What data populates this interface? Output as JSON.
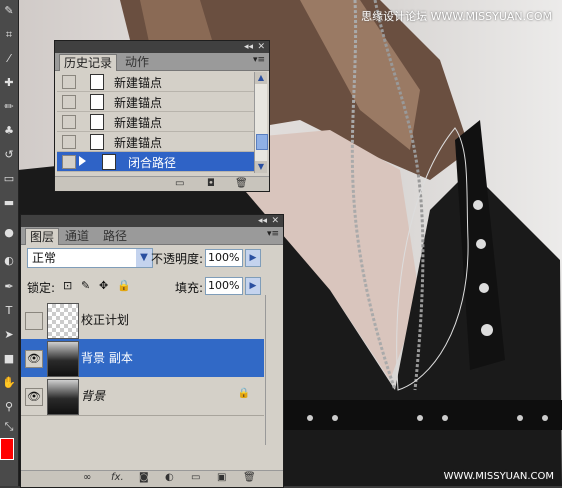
{
  "history_panel": {
    "tabs": [
      {
        "label": "历史记录",
        "active": true
      },
      {
        "label": "动作",
        "active": false
      }
    ],
    "items": [
      {
        "label": "新建锚点",
        "selected": false
      },
      {
        "label": "新建锚点",
        "selected": false
      },
      {
        "label": "新建锚点",
        "selected": false
      },
      {
        "label": "新建锚点",
        "selected": false
      },
      {
        "label": "闭合路径",
        "selected": true
      }
    ],
    "footer_icons": [
      "new-document-from-state-icon",
      "snapshot-icon",
      "trash-icon"
    ]
  },
  "layers_panel": {
    "tabs": [
      {
        "label": "图层",
        "active": true
      },
      {
        "label": "通道",
        "active": false
      },
      {
        "label": "路径",
        "active": false
      }
    ],
    "blend_mode": "正常",
    "opacity_label": "不透明度:",
    "opacity_value": "100%",
    "lock_label": "锁定:",
    "fill_label": "填充:",
    "fill_value": "100%",
    "layers": [
      {
        "name": "校正计划",
        "visible": false,
        "selected": false,
        "locked": false
      },
      {
        "name": "背景 副本",
        "visible": true,
        "selected": true,
        "locked": false
      },
      {
        "name": "背景",
        "visible": true,
        "selected": false,
        "locked": true
      }
    ],
    "footer_icons": [
      "link-icon",
      "fx-icon",
      "mask-icon",
      "adjustment-icon",
      "group-icon",
      "new-layer-icon",
      "trash-icon"
    ],
    "footer_fx_label": "fx."
  },
  "watermarks": {
    "top": "思缘设计论坛 WWW.MISSYUAN.COM",
    "bottom": "WWW.MISSYUAN.COM"
  },
  "colors": {
    "selection": "#3169c6",
    "foreground": "#ff0000",
    "panel": "#d4d0c8"
  }
}
